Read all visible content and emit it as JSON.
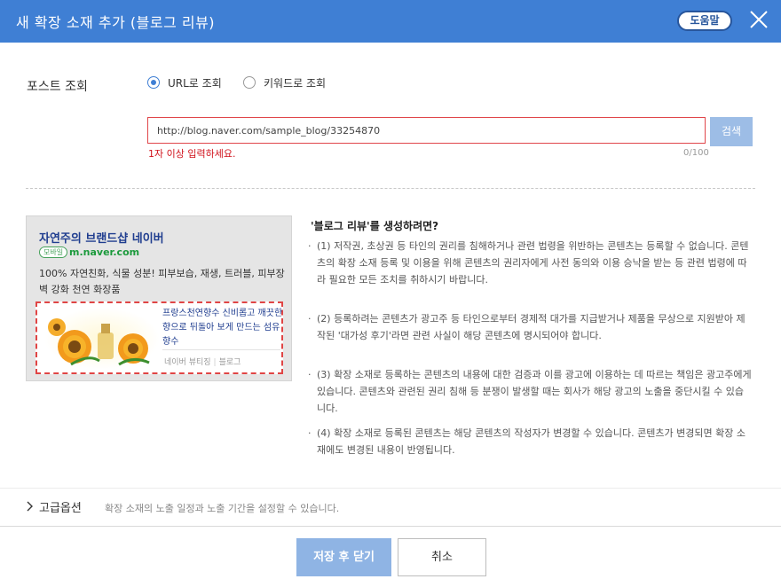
{
  "dialog": {
    "title": "새 확장 소재 추가 (블로그 리뷰)",
    "help_label": "도움말"
  },
  "post_lookup": {
    "label": "포스트 조회",
    "options": [
      {
        "label": "URL로 조회",
        "selected": true
      },
      {
        "label": "키워드로 조회",
        "selected": false
      }
    ],
    "url_value": "http://blog.naver.com/sample_blog/33254870",
    "search_label": "검색",
    "error_text": "1자 이상 입력하세요.",
    "char_count": "0/100"
  },
  "preview": {
    "title": "자연주의 브랜드샵 네이버",
    "badge": "모바일",
    "url": "m.naver.com",
    "description": "100% 자연친화, 식물 성분! 피부보습, 재생, 트러블, 피부장벽 강화 천연 화장품",
    "review_text": "프랑스천연향수 신비롭고 깨끗한 향으로 뒤돌아 보게 만드는 섬유 향수",
    "review_source": "네이버 뷰티징",
    "review_type": "블로그"
  },
  "info": {
    "title": "'블로그 리뷰'를 생성하려면?",
    "items": [
      "(1) 저작권, 초상권 등 타인의 권리를 침해하거나 관련 법령을 위반하는 콘텐츠는 등록할 수 없습니다. 콘텐츠의 확장 소재 등록 및 이용을 위해 콘텐츠의 권리자에게 사전 동의와 이용 승낙을 받는 등 관련 법령에 따라 필요한 모든 조치를 취하시기 바랍니다.",
      "(2) 등록하려는 콘텐츠가 광고주 등 타인으로부터 경제적 대가를 지급받거나 제품을 무상으로 지원받아 제작된 '대가성 후기'라면 관련 사실이 해당 콘텐츠에 명시되어야 합니다.",
      "(3) 확장 소재로 등록하는 콘텐츠의 내용에 대한 검증과 이를 광고에 이용하는 데 따르는 책임은 광고주에게 있습니다. 콘텐츠와 관련된 권리 침해 등 분쟁이 발생할 때는 회사가 해당 광고의 노출을 중단시킬 수 있습니다.",
      "(4) 확장 소재로 등록된 콘텐츠는 해당 콘텐츠의 작성자가 변경할 수 있습니다. 콘텐츠가 변경되면 확장 소재에도 변경된 내용이 반영됩니다."
    ]
  },
  "advanced": {
    "label": "고급옵션",
    "description": "확장 소재의 노출 일정과 노출 기간을 설정할 수 있습니다."
  },
  "footer": {
    "save_label": "저장 후 닫기",
    "cancel_label": "취소"
  },
  "colors": {
    "header": "#3f7fd4",
    "error": "#d0111b",
    "save_button": "#8fb4e4"
  }
}
